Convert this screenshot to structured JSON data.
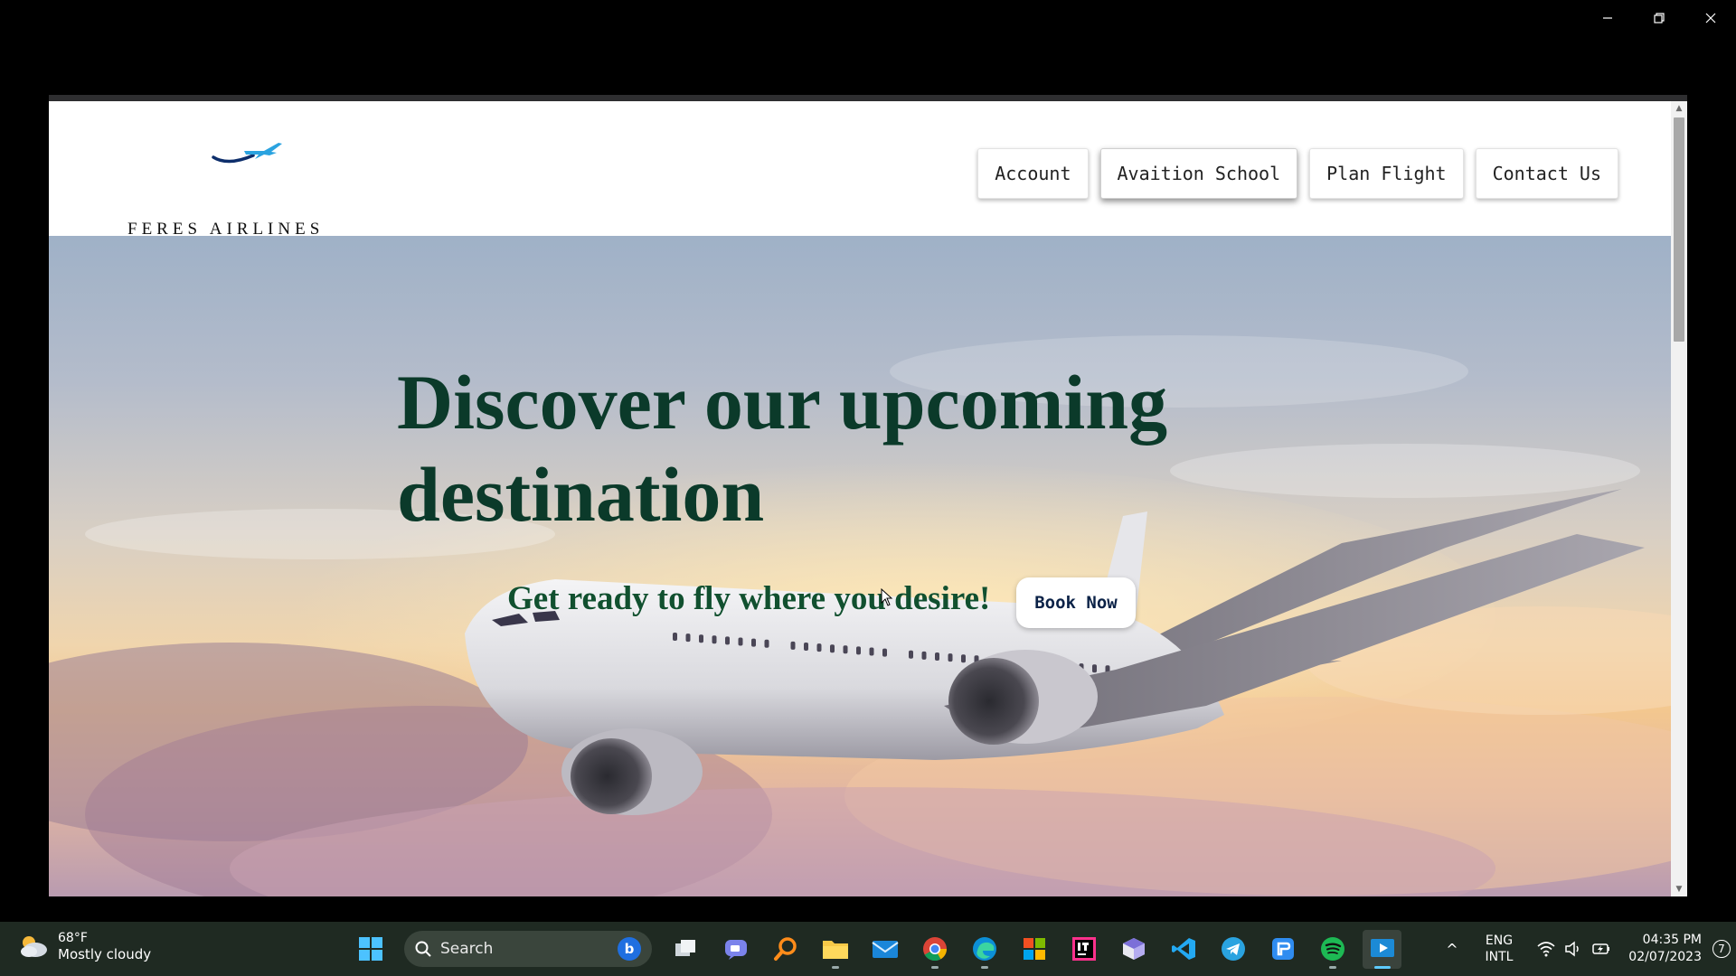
{
  "window": {
    "controls": [
      "minimize",
      "restore",
      "close"
    ]
  },
  "site": {
    "brand": "FERES AIRLINES",
    "logo_icon": "airplane-swoosh-icon",
    "nav": [
      "Account",
      "Avaition School",
      "Plan Flight",
      "Contact Us"
    ],
    "hero": {
      "title": "Discover our upcoming destination",
      "subtitle": "Get ready to fly where you desire!",
      "cta": "Book Now"
    },
    "colors": {
      "title": "#0b3a2a",
      "subtitle": "#11502f",
      "cta_text": "#0b2247"
    }
  },
  "taskbar": {
    "weather": {
      "temp": "68°F",
      "desc": "Mostly cloudy"
    },
    "search_placeholder": "Search",
    "apps": [
      "start",
      "search",
      "task-view",
      "teams-chat",
      "finder-search",
      "file-explorer",
      "mail",
      "chrome",
      "edge",
      "microsoft-store",
      "intellij",
      "git-tool",
      "vscode",
      "telegram",
      "word-app",
      "spotify",
      "media-player"
    ],
    "lang": {
      "line1": "ENG",
      "line2": "INTL"
    },
    "clock": {
      "time": "04:35 PM",
      "date": "02/07/2023"
    },
    "notifications": "7"
  }
}
